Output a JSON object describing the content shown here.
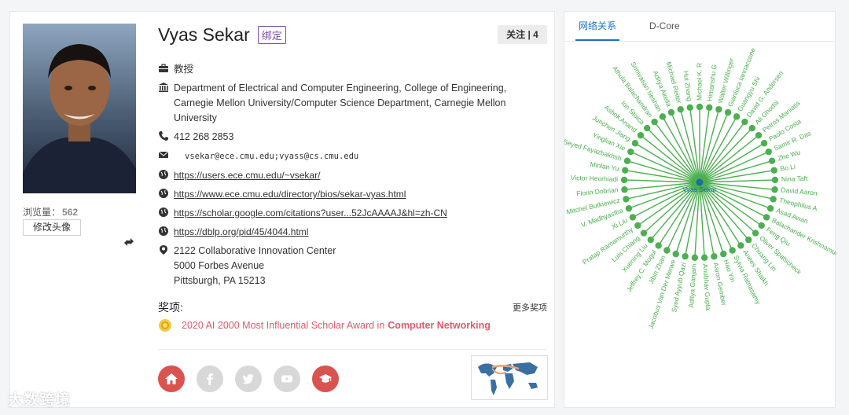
{
  "profile": {
    "name": "Vyas Sekar",
    "bind_label": "绑定",
    "follow_label": "关注 | 4",
    "views_label": "浏览量：",
    "views_count": "562",
    "change_avatar_label": "修改头像",
    "title": "教授",
    "affiliation": "Department of  Electrical and Computer Engineering, College of Engineering, Carnegie Mellon University/Computer Science Department, Carnegie Mellon University",
    "phone": "412 268 2853",
    "email": "vsekar@ece.cmu.edu;vyass@cs.cmu.edu",
    "links": [
      "https://users.ece.cmu.edu/~vsekar/",
      "https://www.ece.cmu.edu/directory/bios/sekar-vyas.html",
      "https://scholar.google.com/citations?user...52JcAAAAJ&hl=zh-CN",
      "https://dblp.org/pid/45/4044.html"
    ],
    "address": [
      "2122 Collaborative Innovation Center",
      "5000 Forbes Avenue",
      "Pittsburgh, PA 15213"
    ],
    "awards_title": "奖项:",
    "more_awards_label": "更多奖项",
    "award": {
      "text": "2020 AI 2000 Most Influential Scholar Award in",
      "field": "Computer Networking"
    },
    "socials": [
      {
        "icon": "home-icon",
        "active": true
      },
      {
        "icon": "facebook-icon",
        "active": false
      },
      {
        "icon": "twitter-icon",
        "active": false
      },
      {
        "icon": "youtube-icon",
        "active": false
      },
      {
        "icon": "graduation-cap-icon",
        "active": true
      }
    ]
  },
  "graph": {
    "tabs": [
      "网络关系",
      "D-Core"
    ],
    "active_tab": 0,
    "center_label": "Vyas Sekar",
    "nodes": [
      "Michael K. R",
      "Himanshu G",
      "Walter Willinger",
      "Gianluca Iannaccone",
      "Guangyu Shi",
      "David G. Andersen",
      "Ali Ghodsi",
      "Petros Maniatis",
      "Paolo Costa",
      "Samir R. Das",
      "Zhe Wu",
      "Bo Li",
      "Nina Taft",
      "David Aaron",
      "Theophilus A",
      "Asad Awan",
      "Balachander Krishnamurthy",
      "Feng Qiu",
      "Oliver Spatscheck",
      "Chuang Lin",
      "Anees Shaikh",
      "Sylvia Ratnasamy",
      "Hao Yin",
      "Aaron Gember",
      "Anubhav Gupta",
      "Aditya Ganjam",
      "Syed Ayyub Qazi",
      "Jacobus Van Der Merwe",
      "Jibin Zhan",
      "Jeffrey C. Mogul",
      "Xuening Liu",
      "Luis Chiang",
      "Pratap Ramamurthy",
      "Xi Liu",
      "V. Madhyastha",
      "Mitchel Butkiewicz",
      "Florin Dobrian",
      "Victor Heorhiadi",
      "Minlan Yu",
      "Seyed Fayazbakhsh",
      "Yinglian Xie",
      "Junchen Jiang",
      "Ashok Anand",
      "Ion Stoica",
      "Athula Balachandran",
      "Srinivasan Seshan",
      "Aditya Akella",
      "Michael Reiter",
      "Hui Zhang"
    ],
    "colors": {
      "node": "#4caf50",
      "center": "#1a6fa8",
      "line": "#4caf50",
      "label": "#4caf50"
    }
  },
  "watermark": "大数跨境",
  "colors": {
    "accent": "#1a73c9",
    "award": "#e05a6a",
    "bind": "#7b4bb0",
    "social_active": "#d9534f"
  }
}
